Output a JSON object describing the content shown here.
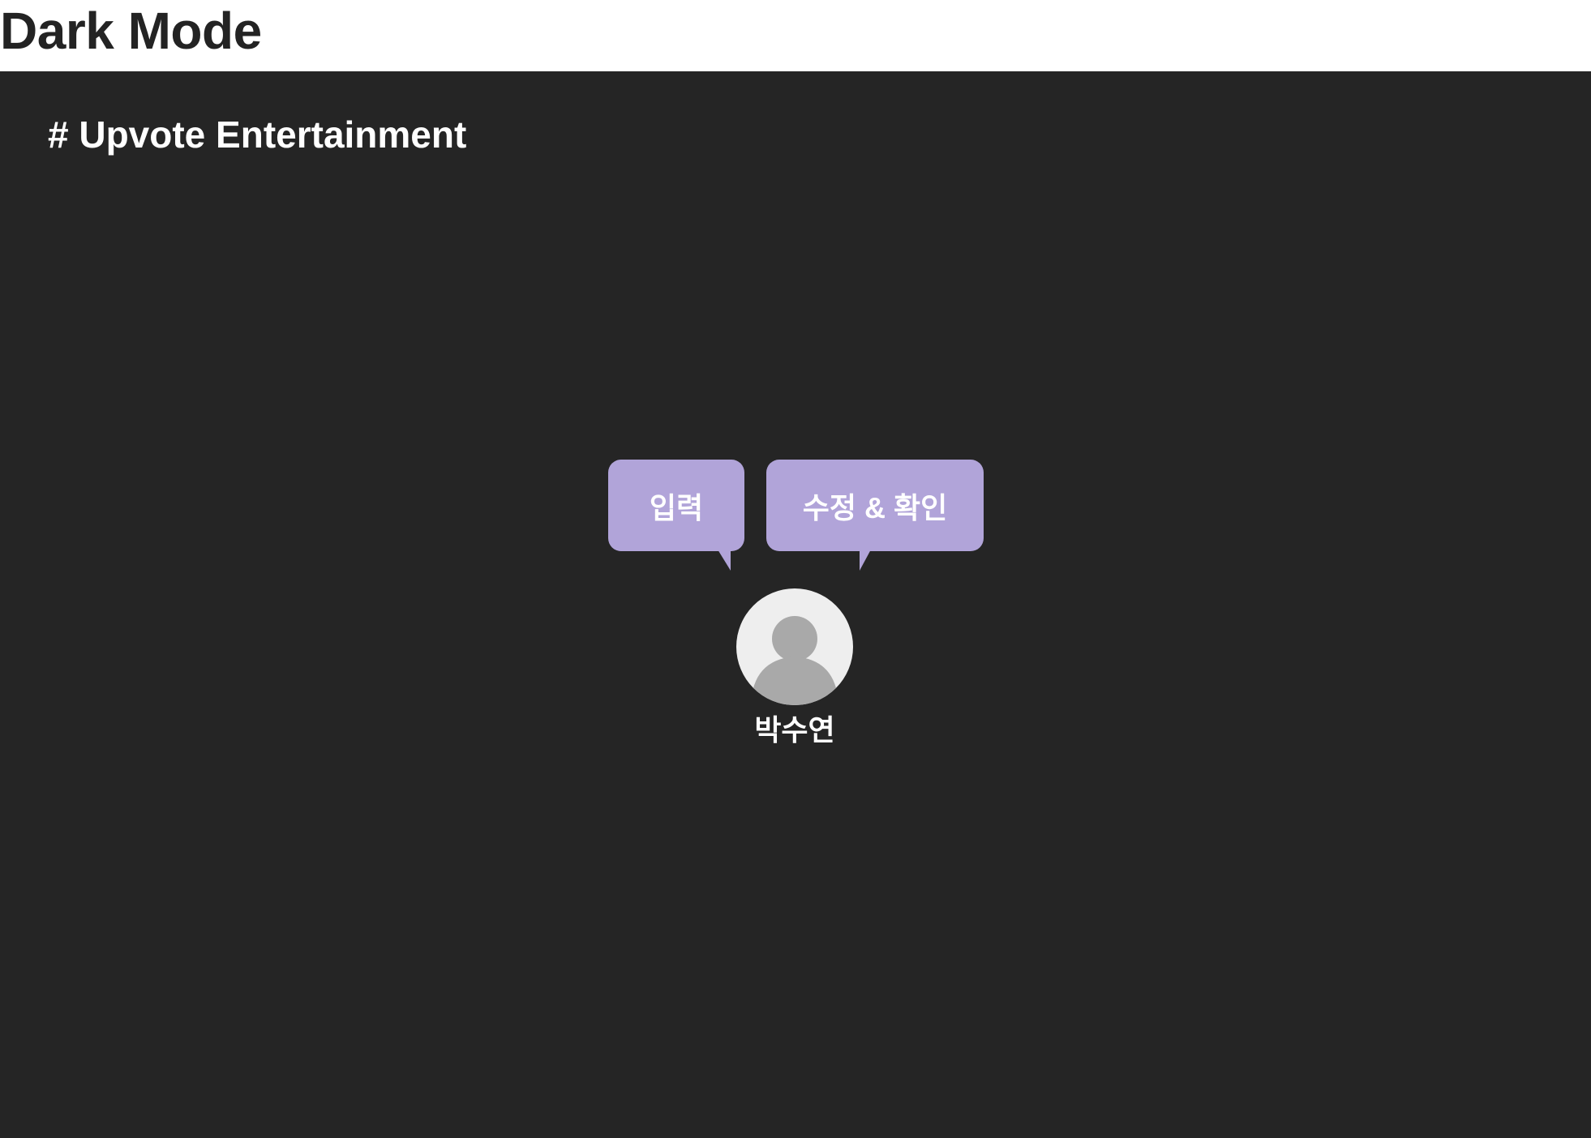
{
  "header": {
    "title": "Dark Mode"
  },
  "panel": {
    "channel_title": "# Upvote Entertainment",
    "background": "#252525"
  },
  "bubbles": {
    "input_label": "입력",
    "edit_confirm_label": "수정 & 확인",
    "color": "#b1a4d9"
  },
  "user": {
    "name": "박수연",
    "avatar_icon": "person-silhouette-icon"
  }
}
